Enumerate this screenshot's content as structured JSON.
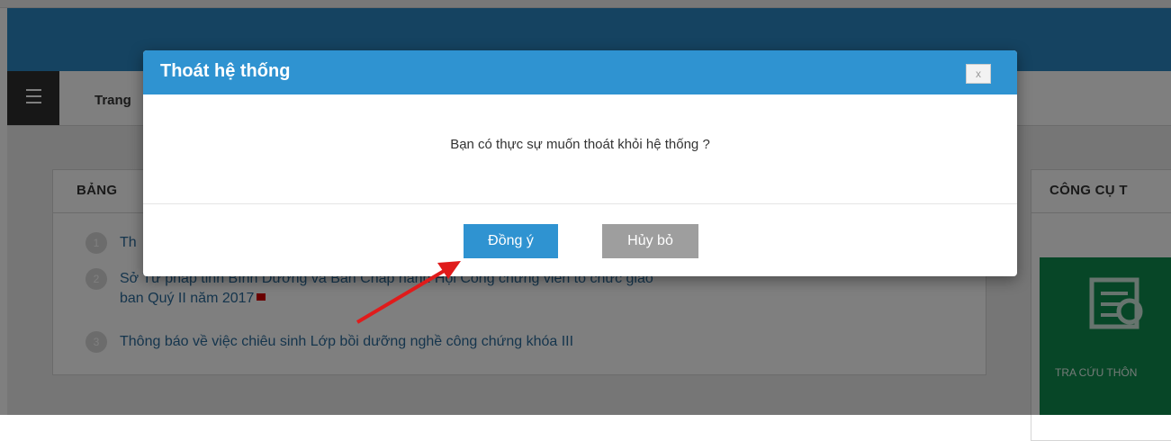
{
  "header": {
    "breadcrumb": "Trang"
  },
  "news": {
    "title": "BẢNG",
    "items": [
      {
        "num": "1",
        "text": "Th"
      },
      {
        "num": "2",
        "text": "Sở Tư pháp tỉnh Bình Dương và Ban Chấp hành Hội Công chứng viên tổ chức giao",
        "text2": "ban Quý II năm 2017"
      },
      {
        "num": "3",
        "text": "Thông báo về việc chiêu sinh Lớp bồi dưỡng nghề công chứng khóa III"
      }
    ]
  },
  "tools": {
    "title": "CÔNG CỤ T",
    "tile_label": "TRA CỨU THÔN"
  },
  "modal": {
    "title": "Thoát hệ thống",
    "close": "x",
    "message": "Bạn có thực sự muốn thoát khỏi hệ thống ?",
    "ok_label": "Đồng ý",
    "cancel_label": "Hủy bỏ"
  },
  "colors": {
    "header": "#2a86c2",
    "modal_header": "#2f93d1",
    "tool_tile": "#0e8d4f",
    "annotation_arrow": "#e01b1b"
  }
}
